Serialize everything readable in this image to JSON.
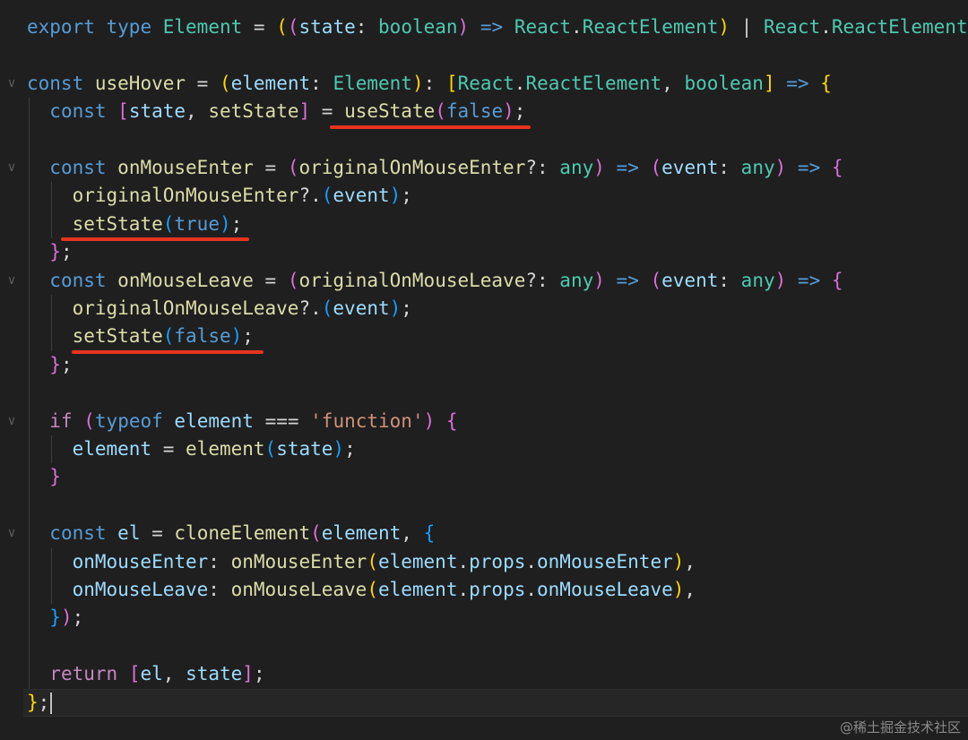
{
  "colors": {
    "background": "#1f1f1f",
    "keyword": "#569cd6",
    "control_keyword": "#c586c0",
    "type": "#4ec9b0",
    "function": "#dcdcaa",
    "variable": "#9cdcfe",
    "string": "#ce9178",
    "bracket_level_1": "#ffd700",
    "bracket_level_2": "#da70d6",
    "bracket_level_3": "#179fff",
    "annotation_underline": "#e8341f"
  },
  "icons": {
    "fold_marker": "chevron-down-icon"
  },
  "code": {
    "lines": [
      [
        [
          "kw",
          "export"
        ],
        [
          "pl",
          " "
        ],
        [
          "kw",
          "type"
        ],
        [
          "pl",
          " "
        ],
        [
          "ty",
          "Element"
        ],
        [
          "pl",
          " = "
        ],
        [
          "b1",
          "("
        ],
        [
          "b2",
          "("
        ],
        [
          "var",
          "state"
        ],
        [
          "pl",
          ": "
        ],
        [
          "ty",
          "boolean"
        ],
        [
          "b2",
          ")"
        ],
        [
          "pl",
          " "
        ],
        [
          "kw",
          "=>"
        ],
        [
          "pl",
          " "
        ],
        [
          "ty",
          "React"
        ],
        [
          "pl",
          "."
        ],
        [
          "ty",
          "ReactElement"
        ],
        [
          "b1",
          ")"
        ],
        [
          "pl",
          " | "
        ],
        [
          "ty",
          "React"
        ],
        [
          "pl",
          "."
        ],
        [
          "ty",
          "ReactElement"
        ],
        [
          "pl",
          ";"
        ]
      ],
      [],
      [
        [
          "kw",
          "const"
        ],
        [
          "pl",
          " "
        ],
        [
          "fn",
          "useHover"
        ],
        [
          "pl",
          " = "
        ],
        [
          "b1",
          "("
        ],
        [
          "var",
          "element"
        ],
        [
          "pl",
          ": "
        ],
        [
          "ty",
          "Element"
        ],
        [
          "b1",
          ")"
        ],
        [
          "pl",
          ": "
        ],
        [
          "b1",
          "["
        ],
        [
          "ty",
          "React"
        ],
        [
          "pl",
          "."
        ],
        [
          "ty",
          "ReactElement"
        ],
        [
          "pl",
          ", "
        ],
        [
          "ty",
          "boolean"
        ],
        [
          "b1",
          "]"
        ],
        [
          "pl",
          " "
        ],
        [
          "kw",
          "=>"
        ],
        [
          "pl",
          " "
        ],
        [
          "b1",
          "{"
        ]
      ],
      [
        [
          "pl",
          "  "
        ],
        [
          "kw",
          "const"
        ],
        [
          "pl",
          " "
        ],
        [
          "b2",
          "["
        ],
        [
          "var",
          "state"
        ],
        [
          "pl",
          ", "
        ],
        [
          "fn",
          "setState"
        ],
        [
          "b2",
          "]"
        ],
        [
          "pl",
          " = "
        ],
        [
          "fn",
          "useState"
        ],
        [
          "b2",
          "("
        ],
        [
          "bool",
          "false"
        ],
        [
          "b2",
          ")"
        ],
        [
          "pl",
          ";"
        ]
      ],
      [],
      [
        [
          "pl",
          "  "
        ],
        [
          "kw",
          "const"
        ],
        [
          "pl",
          " "
        ],
        [
          "fn",
          "onMouseEnter"
        ],
        [
          "pl",
          " = "
        ],
        [
          "b2",
          "("
        ],
        [
          "fn",
          "originalOnMouseEnter"
        ],
        [
          "pl",
          "?: "
        ],
        [
          "ty",
          "any"
        ],
        [
          "b2",
          ")"
        ],
        [
          "pl",
          " "
        ],
        [
          "kw",
          "=>"
        ],
        [
          "pl",
          " "
        ],
        [
          "b2",
          "("
        ],
        [
          "var",
          "event"
        ],
        [
          "pl",
          ": "
        ],
        [
          "ty",
          "any"
        ],
        [
          "b2",
          ")"
        ],
        [
          "pl",
          " "
        ],
        [
          "kw",
          "=>"
        ],
        [
          "pl",
          " "
        ],
        [
          "b2",
          "{"
        ]
      ],
      [
        [
          "pl",
          "    "
        ],
        [
          "fn",
          "originalOnMouseEnter"
        ],
        [
          "pl",
          "?."
        ],
        [
          "b3",
          "("
        ],
        [
          "var",
          "event"
        ],
        [
          "b3",
          ")"
        ],
        [
          "pl",
          ";"
        ]
      ],
      [
        [
          "pl",
          "    "
        ],
        [
          "fn",
          "setState"
        ],
        [
          "b3",
          "("
        ],
        [
          "bool",
          "true"
        ],
        [
          "b3",
          ")"
        ],
        [
          "pl",
          ";"
        ]
      ],
      [
        [
          "pl",
          "  "
        ],
        [
          "b2",
          "}"
        ],
        [
          "pl",
          ";"
        ]
      ],
      [
        [
          "pl",
          "  "
        ],
        [
          "kw",
          "const"
        ],
        [
          "pl",
          " "
        ],
        [
          "fn",
          "onMouseLeave"
        ],
        [
          "pl",
          " = "
        ],
        [
          "b2",
          "("
        ],
        [
          "fn",
          "originalOnMouseLeave"
        ],
        [
          "pl",
          "?: "
        ],
        [
          "ty",
          "any"
        ],
        [
          "b2",
          ")"
        ],
        [
          "pl",
          " "
        ],
        [
          "kw",
          "=>"
        ],
        [
          "pl",
          " "
        ],
        [
          "b2",
          "("
        ],
        [
          "var",
          "event"
        ],
        [
          "pl",
          ": "
        ],
        [
          "ty",
          "any"
        ],
        [
          "b2",
          ")"
        ],
        [
          "pl",
          " "
        ],
        [
          "kw",
          "=>"
        ],
        [
          "pl",
          " "
        ],
        [
          "b2",
          "{"
        ]
      ],
      [
        [
          "pl",
          "    "
        ],
        [
          "fn",
          "originalOnMouseLeave"
        ],
        [
          "pl",
          "?."
        ],
        [
          "b3",
          "("
        ],
        [
          "var",
          "event"
        ],
        [
          "b3",
          ")"
        ],
        [
          "pl",
          ";"
        ]
      ],
      [
        [
          "pl",
          "    "
        ],
        [
          "fn",
          "setState"
        ],
        [
          "b3",
          "("
        ],
        [
          "bool",
          "false"
        ],
        [
          "b3",
          ")"
        ],
        [
          "pl",
          ";"
        ]
      ],
      [
        [
          "pl",
          "  "
        ],
        [
          "b2",
          "}"
        ],
        [
          "pl",
          ";"
        ]
      ],
      [],
      [
        [
          "pl",
          "  "
        ],
        [
          "kw2",
          "if"
        ],
        [
          "pl",
          " "
        ],
        [
          "b2",
          "("
        ],
        [
          "kw",
          "typeof"
        ],
        [
          "pl",
          " "
        ],
        [
          "var",
          "element"
        ],
        [
          "pl",
          " === "
        ],
        [
          "str",
          "'function'"
        ],
        [
          "b2",
          ")"
        ],
        [
          "pl",
          " "
        ],
        [
          "b2",
          "{"
        ]
      ],
      [
        [
          "pl",
          "    "
        ],
        [
          "var",
          "element"
        ],
        [
          "pl",
          " = "
        ],
        [
          "fn",
          "element"
        ],
        [
          "b3",
          "("
        ],
        [
          "var",
          "state"
        ],
        [
          "b3",
          ")"
        ],
        [
          "pl",
          ";"
        ]
      ],
      [
        [
          "pl",
          "  "
        ],
        [
          "b2",
          "}"
        ]
      ],
      [],
      [
        [
          "pl",
          "  "
        ],
        [
          "kw",
          "const"
        ],
        [
          "pl",
          " "
        ],
        [
          "var",
          "el"
        ],
        [
          "pl",
          " = "
        ],
        [
          "fn",
          "cloneElement"
        ],
        [
          "b2",
          "("
        ],
        [
          "var",
          "element"
        ],
        [
          "pl",
          ", "
        ],
        [
          "b3",
          "{"
        ]
      ],
      [
        [
          "pl",
          "    "
        ],
        [
          "var",
          "onMouseEnter"
        ],
        [
          "pl",
          ": "
        ],
        [
          "fn",
          "onMouseEnter"
        ],
        [
          "b1",
          "("
        ],
        [
          "var",
          "element"
        ],
        [
          "pl",
          "."
        ],
        [
          "var",
          "props"
        ],
        [
          "pl",
          "."
        ],
        [
          "var",
          "onMouseEnter"
        ],
        [
          "b1",
          ")"
        ],
        [
          "pl",
          ","
        ]
      ],
      [
        [
          "pl",
          "    "
        ],
        [
          "var",
          "onMouseLeave"
        ],
        [
          "pl",
          ": "
        ],
        [
          "fn",
          "onMouseLeave"
        ],
        [
          "b1",
          "("
        ],
        [
          "var",
          "element"
        ],
        [
          "pl",
          "."
        ],
        [
          "var",
          "props"
        ],
        [
          "pl",
          "."
        ],
        [
          "var",
          "onMouseLeave"
        ],
        [
          "b1",
          ")"
        ],
        [
          "pl",
          ","
        ]
      ],
      [
        [
          "pl",
          "  "
        ],
        [
          "b3",
          "}"
        ],
        [
          "b2",
          ")"
        ],
        [
          "pl",
          ";"
        ]
      ],
      [],
      [
        [
          "pl",
          "  "
        ],
        [
          "kw2",
          "return"
        ],
        [
          "pl",
          " "
        ],
        [
          "b2",
          "["
        ],
        [
          "var",
          "el"
        ],
        [
          "pl",
          ", "
        ],
        [
          "var",
          "state"
        ],
        [
          "b2",
          "]"
        ],
        [
          "pl",
          ";"
        ]
      ],
      [
        [
          "b1",
          "}"
        ],
        [
          "pl",
          ";"
        ]
      ]
    ]
  },
  "watermark": "@稀土掘金技术社区"
}
